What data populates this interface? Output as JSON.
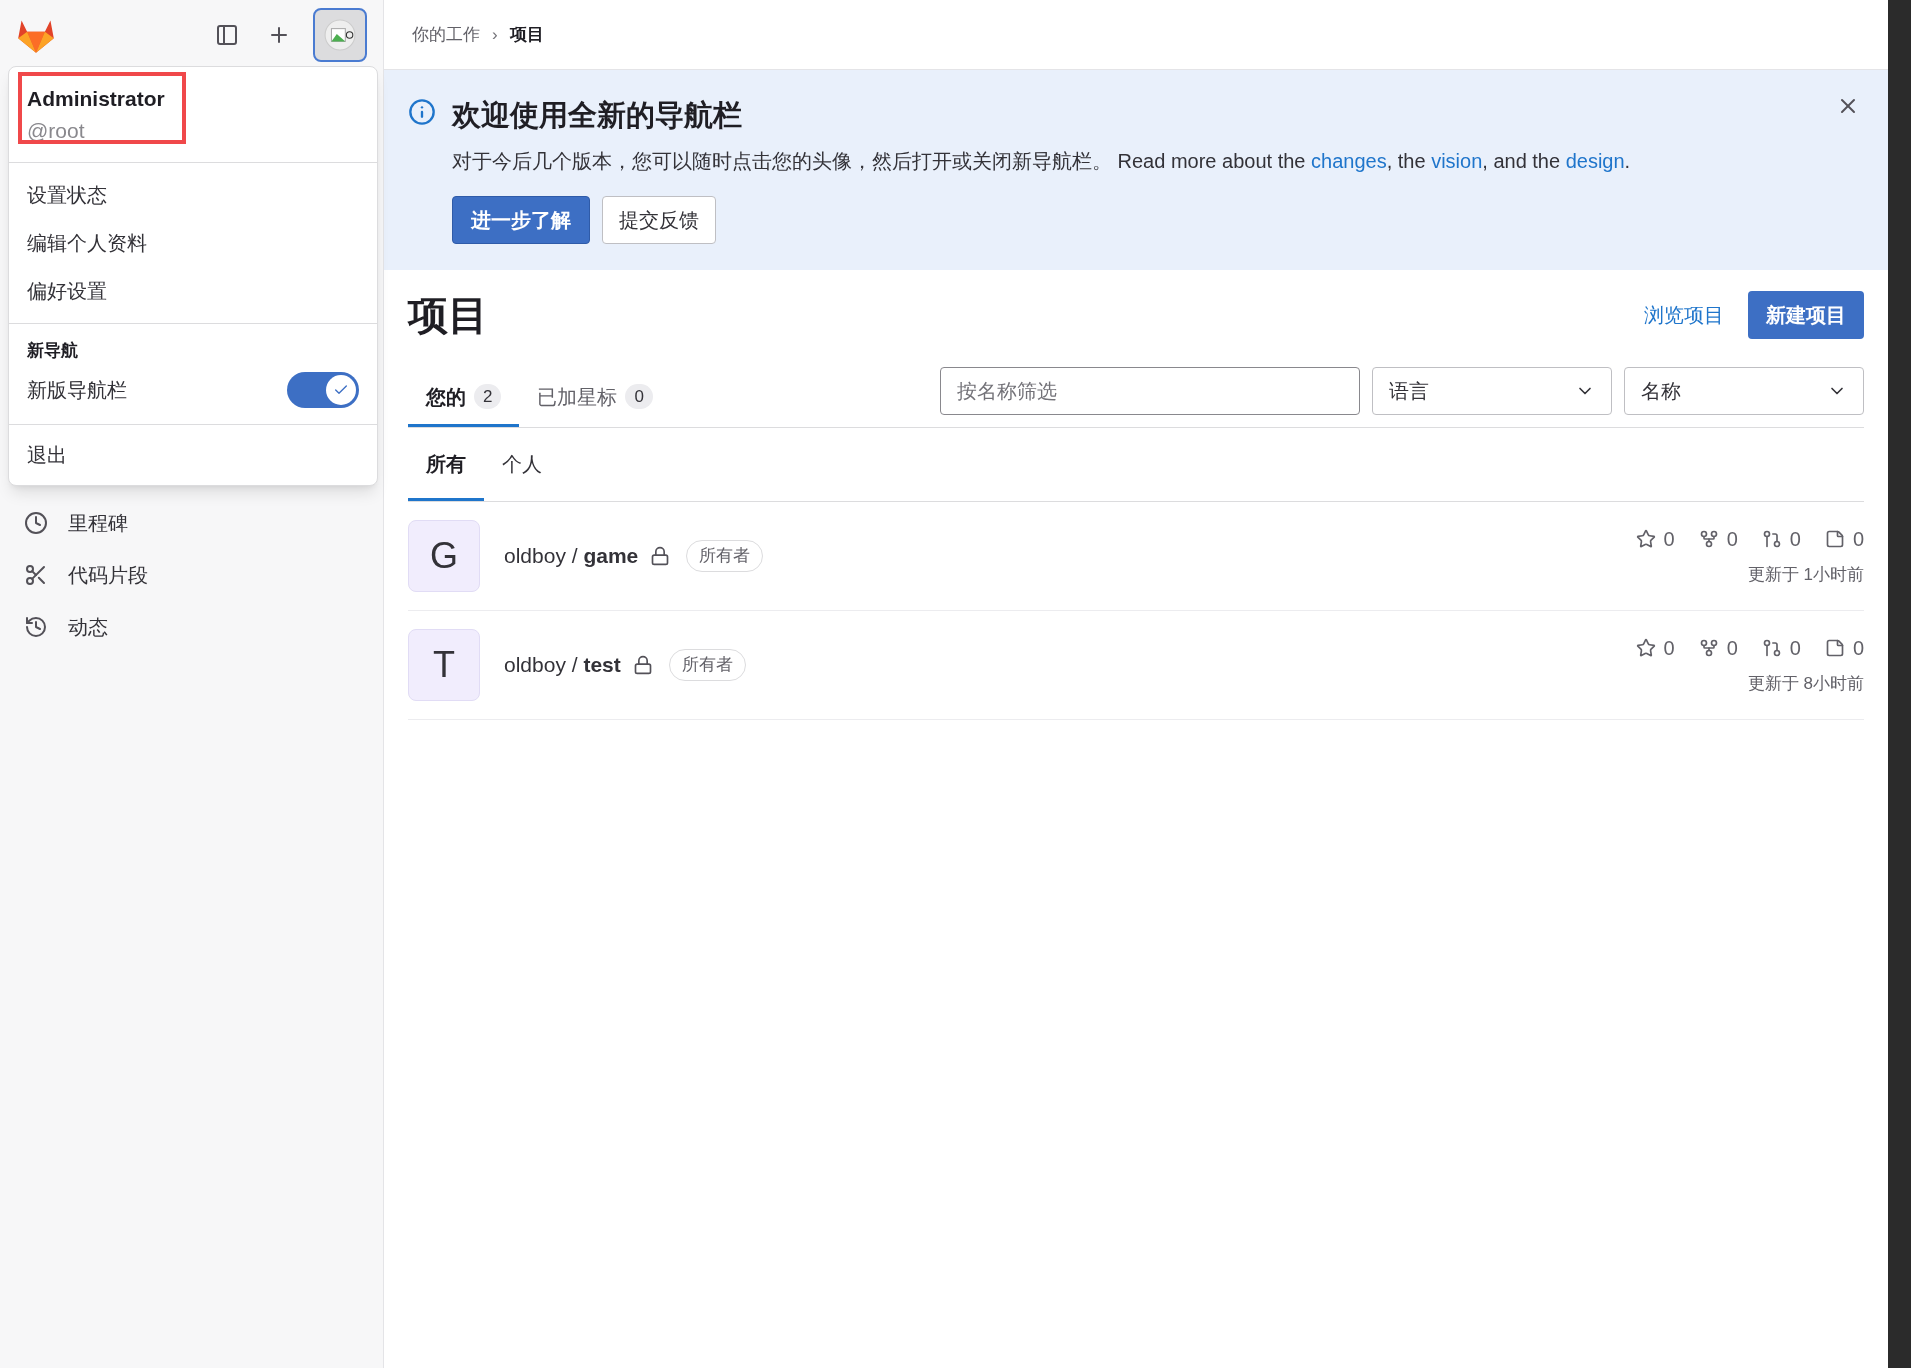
{
  "header": {
    "breadcrumb": [
      {
        "label": "你的工作",
        "current": false
      },
      {
        "label": "项目",
        "current": true
      }
    ],
    "separator": "›"
  },
  "user_menu": {
    "name": "Administrator",
    "username": "@root",
    "items": [
      "设置状态",
      "编辑个人资料",
      "偏好设置"
    ],
    "section_title": "新导航",
    "toggle": {
      "label": "新版导航栏",
      "on": true
    },
    "sign_out": "退出"
  },
  "sidebar": {
    "items": [
      {
        "label": "里程碑",
        "kind": "clock"
      },
      {
        "label": "代码片段",
        "kind": "scissors"
      },
      {
        "label": "动态",
        "kind": "history"
      }
    ]
  },
  "banner": {
    "title": "欢迎使用全新的导航栏",
    "segments": [
      {
        "text": "对于今后几个版本，您可以随时点击您的头像，然后打开或关闭新导航栏。 Read more about the ",
        "link": false
      },
      {
        "text": "changes",
        "link": true
      },
      {
        "text": ", the ",
        "link": false
      },
      {
        "text": "vision",
        "link": true
      },
      {
        "text": ", and the ",
        "link": false
      },
      {
        "text": "design",
        "link": true
      },
      {
        "text": ".",
        "link": false
      }
    ],
    "buttons": [
      {
        "label": "进一步了解",
        "kind": "primary"
      },
      {
        "label": "提交反馈",
        "kind": "secondary"
      }
    ]
  },
  "page": {
    "title": "项目",
    "browse_link": "浏览项目",
    "new_button": "新建项目"
  },
  "tabs": [
    {
      "label": "您的",
      "count": "2",
      "selected": true
    },
    {
      "label": "已加星标",
      "count": "0",
      "selected": false
    }
  ],
  "filter": {
    "placeholder": "按名称筛选"
  },
  "dropdowns": [
    "语言",
    "名称"
  ],
  "subtabs": [
    {
      "label": "所有",
      "selected": true
    },
    {
      "label": "个人",
      "selected": false
    }
  ],
  "projects": [
    {
      "avatar": "G",
      "namespace": "oldboy",
      "separator": "/",
      "name": "game",
      "private": true,
      "role": "所有者",
      "star_count": "0",
      "forks": "0",
      "merge_requests": "0",
      "issues": "0",
      "updated": "更新于 1小时前"
    },
    {
      "avatar": "T",
      "namespace": "oldboy",
      "separator": "/",
      "name": "test",
      "private": true,
      "role": "所有者",
      "star_count": "0",
      "forks": "0",
      "merge_requests": "0",
      "issues": "0",
      "updated": "更新于 8小时前"
    }
  ]
}
